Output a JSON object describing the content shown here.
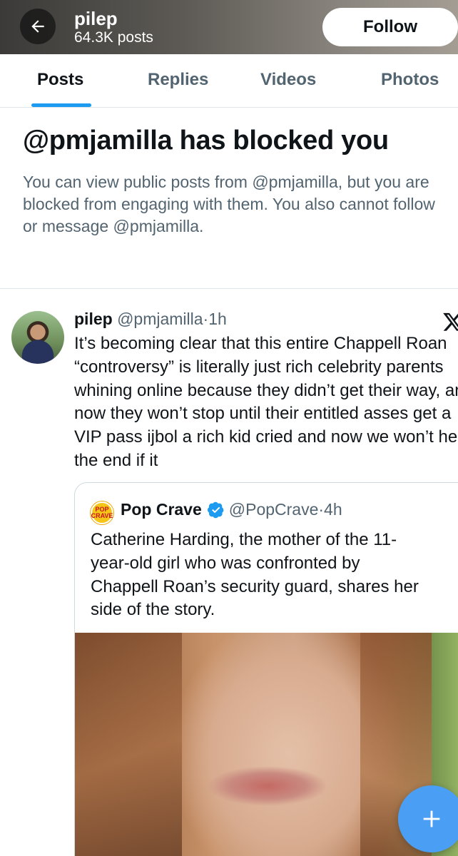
{
  "header": {
    "profile_name": "pilep",
    "post_count": "64.3K posts",
    "follow_label": "Follow"
  },
  "tabs": [
    {
      "label": "Posts",
      "active": true
    },
    {
      "label": "Replies",
      "active": false
    },
    {
      "label": "Videos",
      "active": false
    },
    {
      "label": "Photos",
      "active": false
    }
  ],
  "blocked": {
    "title": "@pmjamilla has blocked you",
    "body": "You can view public posts from @pmjamilla, but you are blocked from engaging with them. You also cannot follow or message @pmjamilla."
  },
  "post": {
    "author_name": "pilep",
    "handle_time": "@pmjamilla·1h",
    "text": "It’s becoming clear that this entire Chappell Roan “controversy” is literally just rich celebrity parents whining online because they didn’t get their way, and now they won’t stop until their entitled asses get a VIP pass ijbol a rich kid cried and now we won’t hear the end if it",
    "quote": {
      "logo_text": "POP CRAVE",
      "author_name": "Pop Crave",
      "handle_time": "@PopCrave·4h",
      "text": "Catherine Harding, the mother of the 11-year-old girl who was confronted by Chappell Roan’s security guard, shares her side of the story."
    }
  },
  "colors": {
    "accent": "#1d9bf0",
    "fab": "#4a9ff5",
    "secondary_text": "#536471"
  },
  "icons": {
    "back": "arrow-left-icon",
    "x_logo": "x-logo-icon",
    "verified": "verified-badge-icon",
    "compose": "plus-icon"
  }
}
